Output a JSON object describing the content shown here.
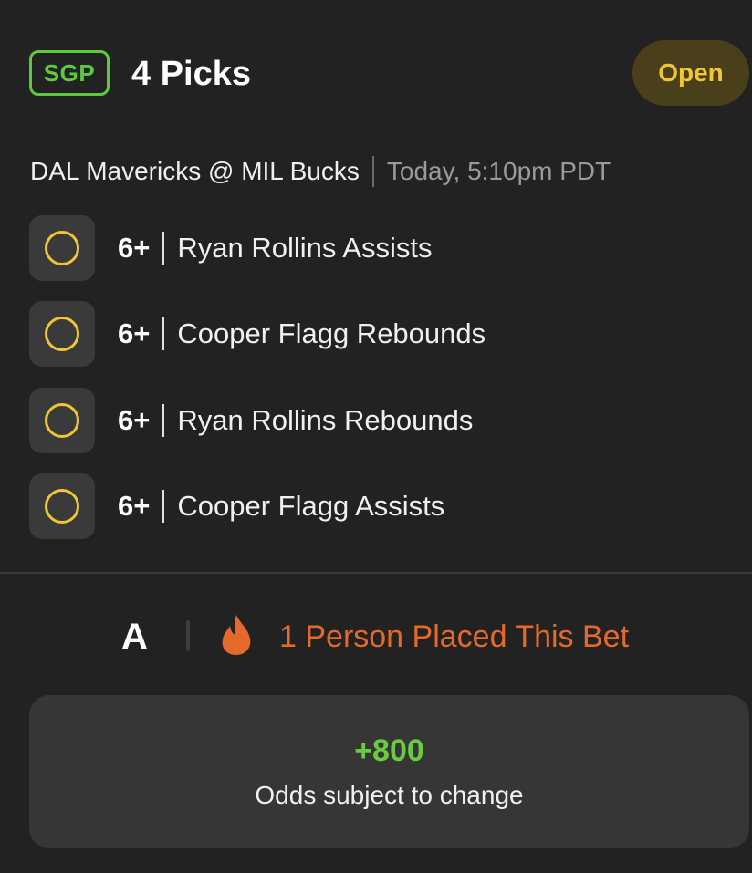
{
  "header": {
    "badge": "SGP",
    "title": "4 Picks",
    "status": "Open"
  },
  "game": {
    "matchup": "DAL Mavericks @ MIL Bucks",
    "time": "Today, 5:10pm PDT"
  },
  "picks": [
    {
      "line": "6+",
      "description": "Ryan Rollins Assists",
      "icon": "pending-circle-icon"
    },
    {
      "line": "6+",
      "description": "Cooper Flagg Rebounds",
      "icon": "pending-circle-icon"
    },
    {
      "line": "6+",
      "description": "Ryan Rollins Rebounds",
      "icon": "pending-circle-icon"
    },
    {
      "line": "6+",
      "description": "Cooper Flagg Assists",
      "icon": "pending-circle-icon"
    }
  ],
  "social": {
    "grade": "A",
    "placed_text": "1 Person Placed This Bet",
    "icon": "flame-icon"
  },
  "odds": {
    "value": "+800",
    "note": "Odds subject to change"
  },
  "colors": {
    "background": "#222222",
    "sgp_green": "#5dc93f",
    "open_text": "#f2c535",
    "open_bg": "#4a3f1b",
    "pending_ring": "#f2c535",
    "flame_orange": "#e4692b",
    "odds_green": "#6bc943"
  }
}
